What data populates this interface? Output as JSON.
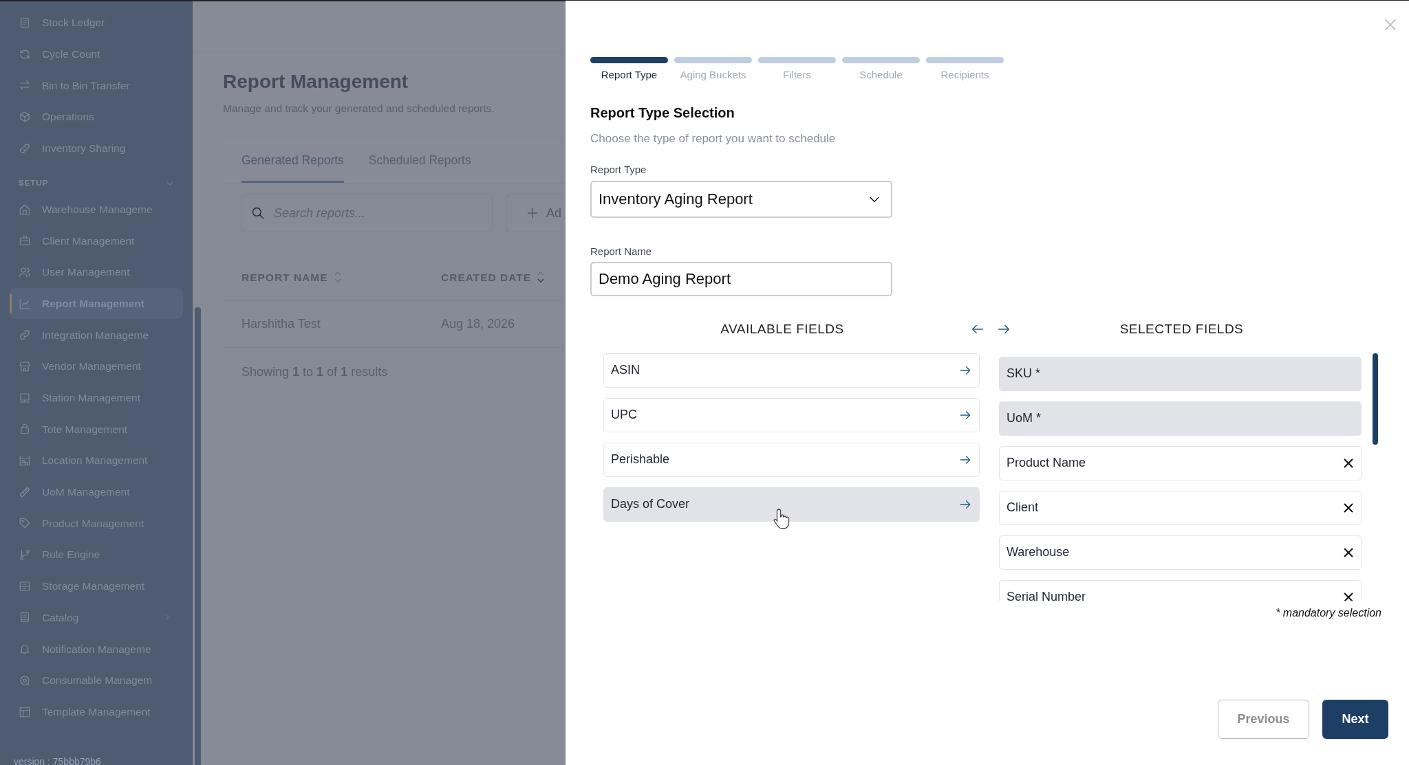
{
  "sidebar": {
    "items": [
      {
        "label": "Stock Ledger",
        "kind": "link",
        "selected": false
      },
      {
        "label": "Cycle Count",
        "kind": "link",
        "selected": false
      },
      {
        "label": "Bin to Bin Transfer",
        "kind": "link",
        "selected": false
      },
      {
        "label": "Operations",
        "kind": "link",
        "selected": false
      },
      {
        "label": "Inventory Sharing",
        "kind": "link",
        "selected": false
      }
    ],
    "section": {
      "title": "SETUP",
      "expanded": true,
      "items": [
        {
          "label": "Warehouse Manageme",
          "kind": "link",
          "selected": false
        },
        {
          "label": "Client Management",
          "kind": "link",
          "selected": false
        },
        {
          "label": "User Management",
          "kind": "link",
          "selected": false
        },
        {
          "label": "Report Management",
          "kind": "link",
          "selected": true
        },
        {
          "label": "Integration Manageme",
          "kind": "link",
          "selected": false
        },
        {
          "label": "Vendor Management",
          "kind": "link",
          "selected": false
        },
        {
          "label": "Station Management",
          "kind": "link",
          "selected": false
        },
        {
          "label": "Tote Management",
          "kind": "link",
          "selected": false
        },
        {
          "label": "Location Management",
          "kind": "link",
          "selected": false
        },
        {
          "label": "UoM Management",
          "kind": "link",
          "selected": false
        },
        {
          "label": "Product Management",
          "kind": "link",
          "selected": false
        },
        {
          "label": "Rule Engine",
          "kind": "link",
          "selected": false
        },
        {
          "label": "Storage Management",
          "kind": "link",
          "selected": false
        },
        {
          "label": "Catalog",
          "kind": "group",
          "expanded": false,
          "selected": false
        },
        {
          "label": "Notification Manageme",
          "kind": "link",
          "selected": false
        },
        {
          "label": "Consumable Managem",
          "kind": "link",
          "selected": false
        },
        {
          "label": "Template Management",
          "kind": "link",
          "selected": false
        }
      ]
    },
    "version": "version : 75bbb79b6"
  },
  "page": {
    "title": "Report Management",
    "subtitle": "Manage and track your generated and scheduled reports.",
    "tabs": [
      {
        "label": "Generated Reports",
        "selected": true
      },
      {
        "label": "Scheduled Reports",
        "selected": false
      }
    ],
    "search": {
      "placeholder": "Search reports..."
    },
    "add_button": "Ad",
    "table": {
      "columns": [
        {
          "label": "REPORT NAME",
          "sorted": false
        },
        {
          "label": "CREATED DATE",
          "sorted": true
        }
      ],
      "rows": [
        [
          "Harshitha Test",
          "Aug 18, 2026"
        ]
      ]
    },
    "footer": "Showing **1** to **1** of **1** results"
  },
  "drawer": {
    "steps": [
      {
        "label": "Report Type",
        "selected": true
      },
      {
        "label": "Aging Buckets",
        "selected": false
      },
      {
        "label": "Filters",
        "selected": false
      },
      {
        "label": "Schedule",
        "selected": false
      },
      {
        "label": "Recipients",
        "selected": false
      }
    ],
    "heading": "Report Type Selection",
    "subtitle": "Choose the type of report you want to schedule",
    "report_type": {
      "label": "Report Type",
      "value": "Inventory Aging Report"
    },
    "report_name": {
      "label": "Report Name",
      "value": "Demo Aging Report"
    },
    "available": {
      "title": "AVAILABLE FIELDS",
      "items": [
        {
          "label": "ASIN",
          "highlighted": false
        },
        {
          "label": "UPC",
          "highlighted": false
        },
        {
          "label": "Perishable",
          "highlighted": false
        },
        {
          "label": "Days of Cover",
          "highlighted": true
        }
      ]
    },
    "selected": {
      "title": "SELECTED FIELDS",
      "items": [
        {
          "label": "SKU *",
          "mandatory": true
        },
        {
          "label": "UoM *",
          "mandatory": true
        },
        {
          "label": "Product Name",
          "mandatory": false
        },
        {
          "label": "Client",
          "mandatory": false
        },
        {
          "label": "Warehouse",
          "mandatory": false
        },
        {
          "label": "Serial Number",
          "mandatory": false
        }
      ]
    },
    "note": "* mandatory selection",
    "buttons": [
      {
        "label": "Previous",
        "kind": "secondary"
      },
      {
        "label": "Next",
        "kind": "primary"
      }
    ]
  }
}
